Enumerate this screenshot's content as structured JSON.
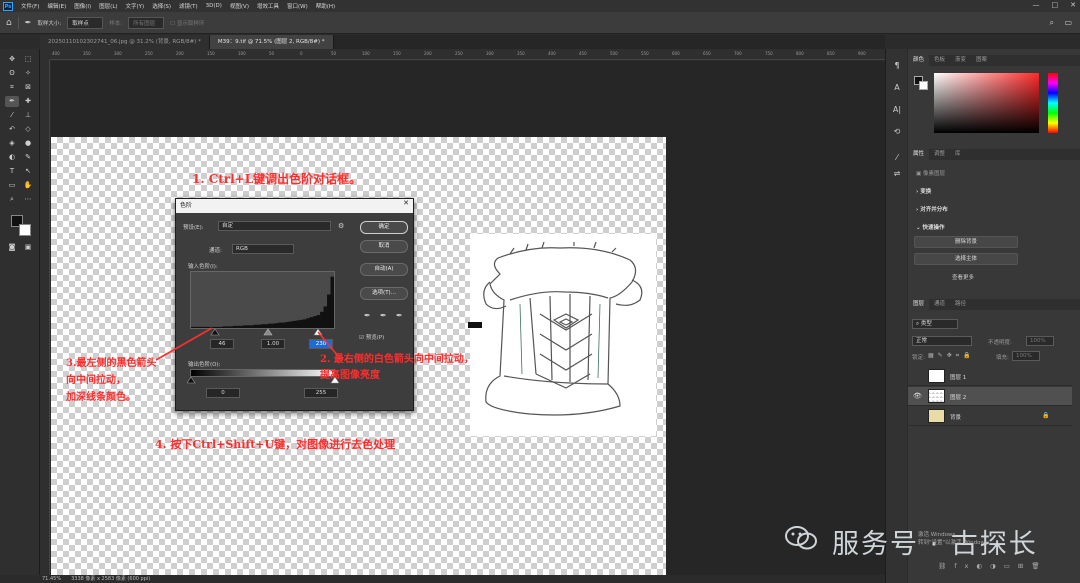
{
  "menubar": {
    "logo": "Ps",
    "items": [
      "文件(F)",
      "编辑(E)",
      "图像(I)",
      "图层(L)",
      "文字(Y)",
      "选择(S)",
      "滤镜(T)",
      "3D(D)",
      "视图(V)",
      "增效工具",
      "窗口(W)",
      "帮助(H)"
    ],
    "min": "—",
    "max": "□",
    "close": "✕"
  },
  "optionsbar": {
    "sample_size_label": "取样大小:",
    "sample_size_value": "取样点",
    "sample_label": "样本:",
    "sample_value": "所有图层",
    "show_ring": "显示取样环"
  },
  "tabs": [
    {
      "label": "20250110102302741_06.jpg @ 31.2% (背景, RGB/8#) *",
      "active": false
    },
    {
      "label": "M39：9.tif @ 71.5% (图层 2, RGB/8#) *",
      "active": true
    }
  ],
  "ruler_labels": [
    "400",
    "350",
    "300",
    "250",
    "200",
    "150",
    "100",
    "50",
    "0",
    "50",
    "100",
    "150",
    "200",
    "250",
    "300",
    "350",
    "400",
    "450",
    "500",
    "550",
    "600",
    "650",
    "700",
    "750",
    "800",
    "850",
    "900"
  ],
  "status": {
    "zoom": "71.45%",
    "doc": "3338 像素 x 2583 像素 (600 ppi)"
  },
  "dialog": {
    "title": "色阶",
    "close": "✕",
    "preset_label": "预设(E):",
    "preset_value": "自定",
    "channel_label": "通道:",
    "channel_value": "RGB",
    "input_label": "输入色阶(I):",
    "input_black": "46",
    "input_mid": "1.00",
    "input_white": "230",
    "output_label": "输出色阶(O):",
    "output_black": "0",
    "output_white": "255",
    "ok": "确定",
    "cancel": "取消",
    "auto": "自动(A)",
    "options": "选项(T)...",
    "preview": "预览(P)",
    "histogram": [
      2,
      2,
      2,
      2,
      2,
      2,
      2,
      2,
      2,
      3,
      3,
      3,
      4,
      4,
      4,
      5,
      5,
      5,
      6,
      6,
      7,
      7,
      8,
      8,
      9,
      10,
      10,
      11,
      12,
      13,
      14,
      15,
      16,
      18,
      20,
      22,
      24,
      30,
      40,
      62,
      95
    ]
  },
  "annotations": {
    "a1": "1. Ctrl+L键调出色阶对话框。",
    "a2_l1": "2. 最右侧的白色箭头向中间拉动，",
    "a2_l2": "提高图像亮度",
    "a3_l1": "3.最左侧的黑色箭头",
    "a3_l2": "向中间拉动，",
    "a3_l3": "加深线条颜色。",
    "a4": "4. 按下Ctrl+Shift+U键，对图像进行去色处理"
  },
  "panels": {
    "color_tabs": [
      "颜色",
      "色板",
      "渐变",
      "图案"
    ],
    "props_tabs": [
      "属性",
      "调整",
      "库"
    ],
    "pixel_layer": "像素图层",
    "transform": "变换",
    "align": "对齐并分布",
    "quick_actions": "快速操作",
    "remove_bg": "删除背景",
    "select_subject": "选择主体",
    "learn_more": "查看更多",
    "layers_tabs": [
      "图层",
      "通道",
      "路径"
    ],
    "kind": "类型",
    "blend": "正常",
    "opacity_label": "不透明度:",
    "opacity": "100%",
    "lock_label": "锁定:",
    "fill_label": "填充:",
    "fill": "100%",
    "layers": [
      {
        "name": "图层 1",
        "selected": false,
        "visible": false
      },
      {
        "name": "图层 2",
        "selected": true,
        "visible": true
      },
      {
        "name": "背景",
        "selected": false,
        "visible": false
      }
    ]
  },
  "watermark": {
    "text": "服务号 · 古探长"
  },
  "windows": {
    "l1": "激活 Windows",
    "l2": "转到\"设置\"以激活 Windows。"
  }
}
